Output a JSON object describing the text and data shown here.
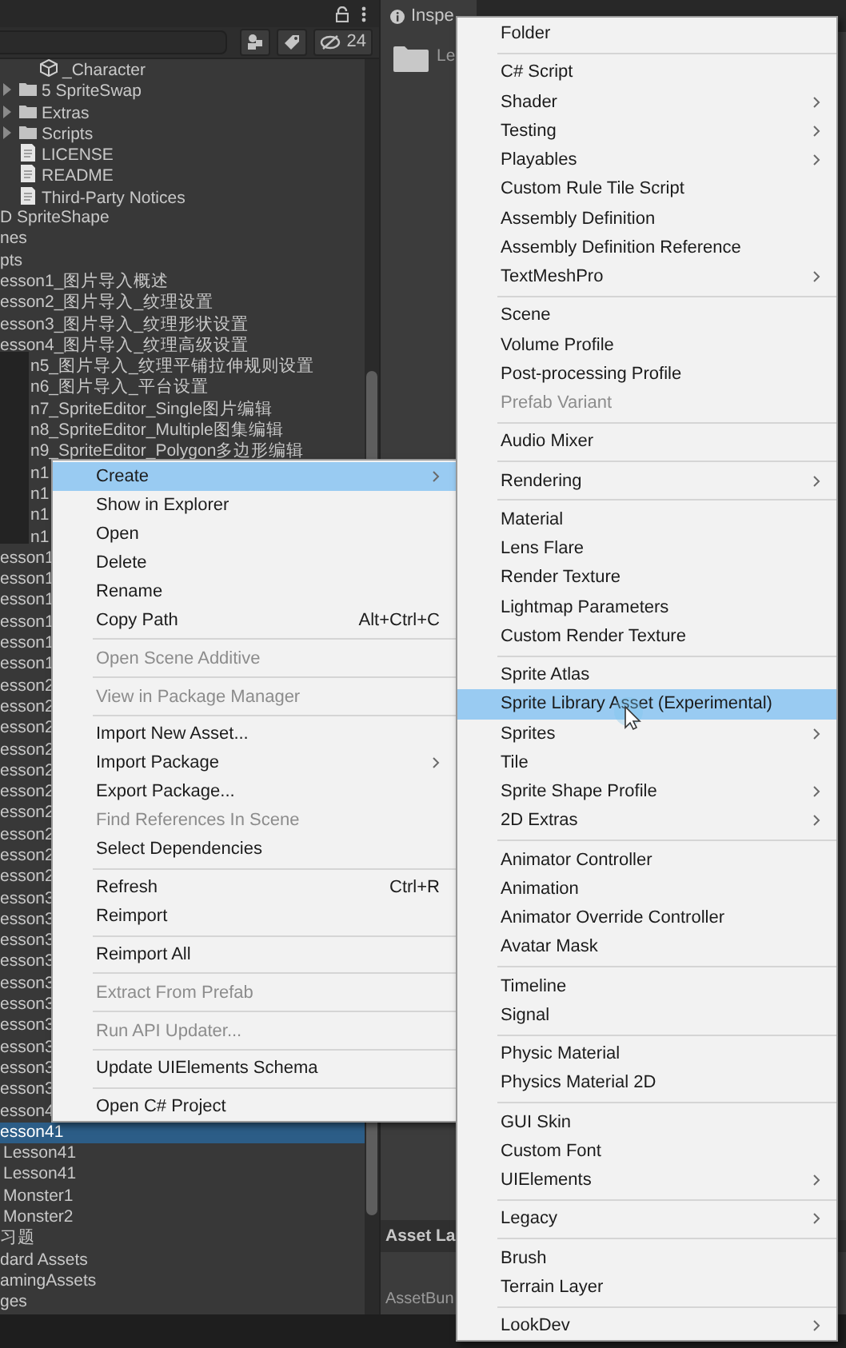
{
  "project_panel": {
    "hidden_count": "24",
    "tree": [
      {
        "children": [
          {
            "children": [
              {
                "label": "_Character",
                "kind": "prefab",
                "selected": false
              }
            ]
          },
          {
            "label": "5 SpriteSwap",
            "kind": "folder",
            "expanded": false,
            "selected": false
          },
          {
            "label": "Extras",
            "kind": "folder",
            "expanded": false,
            "selected": false
          },
          {
            "label": "Scripts",
            "kind": "folder",
            "expanded": false,
            "selected": false
          },
          {
            "label": "LICENSE",
            "kind": "file",
            "selected": false
          },
          {
            "label": "README",
            "kind": "file",
            "selected": false
          },
          {
            "label": "Third-Party Notices",
            "kind": "file",
            "selected": false
          }
        ]
      },
      {
        "label": "D SpriteShape",
        "kind": "node",
        "selected": false
      },
      {
        "label": "nes",
        "kind": "node",
        "selected": false
      },
      {
        "label": "pts",
        "kind": "node",
        "selected": false
      },
      {
        "label": "esson1_图片导入概述",
        "kind": "node",
        "selected": false
      },
      {
        "label": "esson2_图片导入_纹理设置",
        "kind": "node",
        "selected": false
      },
      {
        "label": "esson3_图片导入_纹理形状设置",
        "kind": "node",
        "selected": false
      },
      {
        "label": "esson4_图片导入_纹理高级设置",
        "kind": "node",
        "selected": false
      },
      {
        "label": "n5_图片导入_纹理平铺拉伸规则设置",
        "kind": "node",
        "selected": false
      },
      {
        "label": "n6_图片导入_平台设置",
        "kind": "node",
        "selected": false
      },
      {
        "label": "n7_SpriteEditor_Single图片编辑",
        "kind": "node",
        "selected": false
      },
      {
        "label": "n8_SpriteEditor_Multiple图集编辑",
        "kind": "node",
        "selected": false
      },
      {
        "label": "n9_SpriteEditor_Polygon多边形编辑",
        "kind": "node",
        "selected": false
      },
      {
        "label": "n1",
        "kind": "node",
        "selected": false
      },
      {
        "label": "n1",
        "kind": "node",
        "selected": false
      },
      {
        "label": "n1",
        "kind": "node",
        "selected": false
      },
      {
        "label": "n1",
        "kind": "node",
        "selected": false
      },
      {
        "label": "esson1",
        "kind": "node",
        "selected": false
      },
      {
        "label": "esson1",
        "kind": "node",
        "selected": false
      },
      {
        "label": "esson1",
        "kind": "node",
        "selected": false
      },
      {
        "label": "esson1",
        "kind": "node",
        "selected": false
      },
      {
        "label": "esson1",
        "kind": "node",
        "selected": false
      },
      {
        "label": "esson1",
        "kind": "node",
        "selected": false
      },
      {
        "label": "esson2",
        "kind": "node",
        "selected": false
      },
      {
        "label": "esson2",
        "kind": "node",
        "selected": false
      },
      {
        "label": "esson2",
        "kind": "node",
        "selected": false
      },
      {
        "label": "esson2",
        "kind": "node",
        "selected": false
      },
      {
        "label": "esson2",
        "kind": "node",
        "selected": false
      },
      {
        "label": "esson2",
        "kind": "node",
        "selected": false
      },
      {
        "label": "esson2",
        "kind": "node",
        "selected": false
      },
      {
        "label": "esson2",
        "kind": "node",
        "selected": false
      },
      {
        "label": "esson2",
        "kind": "node",
        "selected": false
      },
      {
        "label": "esson2",
        "kind": "node",
        "selected": false
      },
      {
        "label": "esson3",
        "kind": "node",
        "selected": false
      },
      {
        "label": "esson3",
        "kind": "node",
        "selected": false
      },
      {
        "label": "esson3",
        "kind": "node",
        "selected": false
      },
      {
        "label": "esson3",
        "kind": "node",
        "selected": false
      },
      {
        "label": "esson3",
        "kind": "node",
        "selected": false
      },
      {
        "label": "esson3",
        "kind": "node",
        "selected": false
      },
      {
        "label": "esson3",
        "kind": "node",
        "selected": false
      },
      {
        "label": "esson3",
        "kind": "node",
        "selected": false
      },
      {
        "label": "esson3",
        "kind": "node",
        "selected": false
      },
      {
        "label": "esson3",
        "kind": "node",
        "selected": false
      },
      {
        "label": "esson4",
        "kind": "node",
        "selected": false
      },
      {
        "label": "esson41",
        "kind": "node",
        "selected": true,
        "children": [
          {
            "label": "Lesson41",
            "kind": "node",
            "selected": false
          },
          {
            "label": "Lesson41",
            "kind": "node",
            "selected": false
          },
          {
            "label": "Monster1",
            "kind": "node",
            "selected": false
          },
          {
            "label": "Monster2",
            "kind": "node",
            "selected": false
          }
        ]
      },
      {
        "label": "习题",
        "kind": "node",
        "selected": false
      },
      {
        "label": "dard Assets",
        "kind": "node",
        "selected": false
      },
      {
        "label": "amingAssets",
        "kind": "node",
        "selected": false
      },
      {
        "label": "ges",
        "kind": "node",
        "selected": false
      }
    ]
  },
  "inspector": {
    "tab": "Inspe",
    "asset_name": "Le",
    "section_header": "Asset La",
    "field_label": "AssetBun"
  },
  "context_menu": [
    {
      "kind": "item",
      "label": "Create",
      "selected": true,
      "disabled": false,
      "submenu": true
    },
    {
      "kind": "item",
      "label": "Show in Explorer",
      "selected": false,
      "disabled": false,
      "submenu": false
    },
    {
      "kind": "item",
      "label": "Open",
      "selected": false,
      "disabled": false,
      "submenu": false
    },
    {
      "kind": "item",
      "label": "Delete",
      "selected": false,
      "disabled": false,
      "submenu": false
    },
    {
      "kind": "item",
      "label": "Rename",
      "selected": false,
      "disabled": false,
      "submenu": false
    },
    {
      "kind": "item",
      "label": "Copy Path",
      "shortcut": "Alt+Ctrl+C",
      "selected": false,
      "disabled": false,
      "submenu": false
    },
    {
      "kind": "separator"
    },
    {
      "kind": "item",
      "label": "Open Scene Additive",
      "selected": false,
      "disabled": true,
      "submenu": false
    },
    {
      "kind": "separator"
    },
    {
      "kind": "item",
      "label": "View in Package Manager",
      "selected": false,
      "disabled": true,
      "submenu": false
    },
    {
      "kind": "separator"
    },
    {
      "kind": "item",
      "label": "Import New Asset...",
      "selected": false,
      "disabled": false,
      "submenu": false
    },
    {
      "kind": "item",
      "label": "Import Package",
      "selected": false,
      "disabled": false,
      "submenu": true
    },
    {
      "kind": "item",
      "label": "Export Package...",
      "selected": false,
      "disabled": false,
      "submenu": false
    },
    {
      "kind": "item",
      "label": "Find References In Scene",
      "selected": false,
      "disabled": true,
      "submenu": false
    },
    {
      "kind": "item",
      "label": "Select Dependencies",
      "selected": false,
      "disabled": false,
      "submenu": false
    },
    {
      "kind": "separator"
    },
    {
      "kind": "item",
      "label": "Refresh",
      "shortcut": "Ctrl+R",
      "selected": false,
      "disabled": false,
      "submenu": false
    },
    {
      "kind": "item",
      "label": "Reimport",
      "selected": false,
      "disabled": false,
      "submenu": false
    },
    {
      "kind": "separator"
    },
    {
      "kind": "item",
      "label": "Reimport All",
      "selected": false,
      "disabled": false,
      "submenu": false
    },
    {
      "kind": "separator"
    },
    {
      "kind": "item",
      "label": "Extract From Prefab",
      "selected": false,
      "disabled": true,
      "submenu": false
    },
    {
      "kind": "separator"
    },
    {
      "kind": "item",
      "label": "Run API Updater...",
      "selected": false,
      "disabled": true,
      "submenu": false
    },
    {
      "kind": "separator"
    },
    {
      "kind": "item",
      "label": "Update UIElements Schema",
      "selected": false,
      "disabled": false,
      "submenu": false
    },
    {
      "kind": "separator"
    },
    {
      "kind": "item",
      "label": "Open C# Project",
      "selected": false,
      "disabled": false,
      "submenu": false
    }
  ],
  "create_submenu": [
    {
      "kind": "item",
      "label": "Folder",
      "selected": false,
      "disabled": false,
      "submenu": false
    },
    {
      "kind": "separator"
    },
    {
      "kind": "item",
      "label": "C# Script",
      "selected": false,
      "disabled": false,
      "submenu": false
    },
    {
      "kind": "item",
      "label": "Shader",
      "selected": false,
      "disabled": false,
      "submenu": true
    },
    {
      "kind": "item",
      "label": "Testing",
      "selected": false,
      "disabled": false,
      "submenu": true
    },
    {
      "kind": "item",
      "label": "Playables",
      "selected": false,
      "disabled": false,
      "submenu": true
    },
    {
      "kind": "item",
      "label": "Custom Rule Tile Script",
      "selected": false,
      "disabled": false,
      "submenu": false
    },
    {
      "kind": "item",
      "label": "Assembly Definition",
      "selected": false,
      "disabled": false,
      "submenu": false
    },
    {
      "kind": "item",
      "label": "Assembly Definition Reference",
      "selected": false,
      "disabled": false,
      "submenu": false
    },
    {
      "kind": "item",
      "label": "TextMeshPro",
      "selected": false,
      "disabled": false,
      "submenu": true
    },
    {
      "kind": "separator"
    },
    {
      "kind": "item",
      "label": "Scene",
      "selected": false,
      "disabled": false,
      "submenu": false
    },
    {
      "kind": "item",
      "label": "Volume Profile",
      "selected": false,
      "disabled": false,
      "submenu": false
    },
    {
      "kind": "item",
      "label": "Post-processing Profile",
      "selected": false,
      "disabled": false,
      "submenu": false
    },
    {
      "kind": "item",
      "label": "Prefab Variant",
      "selected": false,
      "disabled": true,
      "submenu": false
    },
    {
      "kind": "separator"
    },
    {
      "kind": "item",
      "label": "Audio Mixer",
      "selected": false,
      "disabled": false,
      "submenu": false
    },
    {
      "kind": "separator"
    },
    {
      "kind": "item",
      "label": "Rendering",
      "selected": false,
      "disabled": false,
      "submenu": true
    },
    {
      "kind": "separator"
    },
    {
      "kind": "item",
      "label": "Material",
      "selected": false,
      "disabled": false,
      "submenu": false
    },
    {
      "kind": "item",
      "label": "Lens Flare",
      "selected": false,
      "disabled": false,
      "submenu": false
    },
    {
      "kind": "item",
      "label": "Render Texture",
      "selected": false,
      "disabled": false,
      "submenu": false
    },
    {
      "kind": "item",
      "label": "Lightmap Parameters",
      "selected": false,
      "disabled": false,
      "submenu": false
    },
    {
      "kind": "item",
      "label": "Custom Render Texture",
      "selected": false,
      "disabled": false,
      "submenu": false
    },
    {
      "kind": "separator"
    },
    {
      "kind": "item",
      "label": "Sprite Atlas",
      "selected": false,
      "disabled": false,
      "submenu": false
    },
    {
      "kind": "item",
      "label": "Sprite Library Asset (Experimental)",
      "selected": true,
      "disabled": false,
      "submenu": false
    },
    {
      "kind": "item",
      "label": "Sprites",
      "selected": false,
      "disabled": false,
      "submenu": true
    },
    {
      "kind": "item",
      "label": "Tile",
      "selected": false,
      "disabled": false,
      "submenu": false
    },
    {
      "kind": "item",
      "label": "Sprite Shape Profile",
      "selected": false,
      "disabled": false,
      "submenu": true
    },
    {
      "kind": "item",
      "label": "2D Extras",
      "selected": false,
      "disabled": false,
      "submenu": true
    },
    {
      "kind": "separator"
    },
    {
      "kind": "item",
      "label": "Animator Controller",
      "selected": false,
      "disabled": false,
      "submenu": false
    },
    {
      "kind": "item",
      "label": "Animation",
      "selected": false,
      "disabled": false,
      "submenu": false
    },
    {
      "kind": "item",
      "label": "Animator Override Controller",
      "selected": false,
      "disabled": false,
      "submenu": false
    },
    {
      "kind": "item",
      "label": "Avatar Mask",
      "selected": false,
      "disabled": false,
      "submenu": false
    },
    {
      "kind": "separator"
    },
    {
      "kind": "item",
      "label": "Timeline",
      "selected": false,
      "disabled": false,
      "submenu": false
    },
    {
      "kind": "item",
      "label": "Signal",
      "selected": false,
      "disabled": false,
      "submenu": false
    },
    {
      "kind": "separator"
    },
    {
      "kind": "item",
      "label": "Physic Material",
      "selected": false,
      "disabled": false,
      "submenu": false
    },
    {
      "kind": "item",
      "label": "Physics Material 2D",
      "selected": false,
      "disabled": false,
      "submenu": false
    },
    {
      "kind": "separator"
    },
    {
      "kind": "item",
      "label": "GUI Skin",
      "selected": false,
      "disabled": false,
      "submenu": false
    },
    {
      "kind": "item",
      "label": "Custom Font",
      "selected": false,
      "disabled": false,
      "submenu": false
    },
    {
      "kind": "item",
      "label": "UIElements",
      "selected": false,
      "disabled": false,
      "submenu": true
    },
    {
      "kind": "separator"
    },
    {
      "kind": "item",
      "label": "Legacy",
      "selected": false,
      "disabled": false,
      "submenu": true
    },
    {
      "kind": "separator"
    },
    {
      "kind": "item",
      "label": "Brush",
      "selected": false,
      "disabled": false,
      "submenu": false
    },
    {
      "kind": "item",
      "label": "Terrain Layer",
      "selected": false,
      "disabled": false,
      "submenu": false
    },
    {
      "kind": "separator"
    },
    {
      "kind": "item",
      "label": "LookDev",
      "selected": false,
      "disabled": false,
      "submenu": true
    }
  ]
}
